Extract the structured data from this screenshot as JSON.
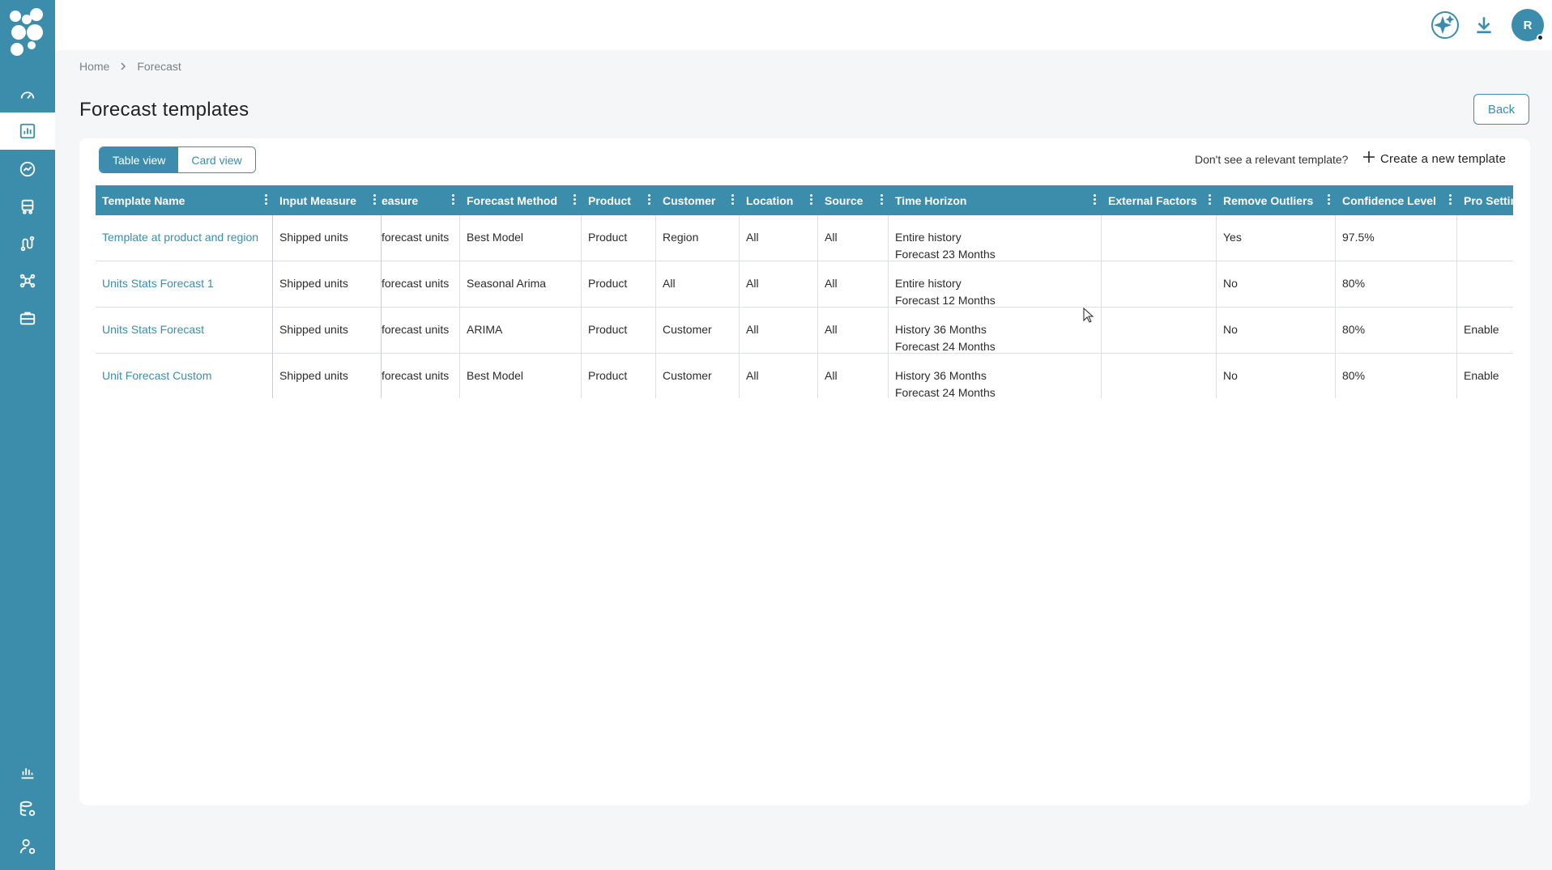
{
  "colors": {
    "accent": "#3b8dab",
    "header_text": "#ffffff",
    "link": "#3b8dab"
  },
  "sidebar": {
    "logo": "app-logo",
    "items": [
      {
        "icon": "speedometer-icon"
      },
      {
        "icon": "bar-chart-icon",
        "active": true
      },
      {
        "icon": "trend-icon"
      },
      {
        "icon": "truck-icon"
      },
      {
        "icon": "route-icon"
      },
      {
        "icon": "network-icon"
      },
      {
        "icon": "briefcase-icon"
      }
    ],
    "bottom_items": [
      {
        "icon": "report-icon"
      },
      {
        "icon": "database-settings-icon"
      },
      {
        "icon": "user-settings-icon"
      }
    ]
  },
  "topbar": {
    "icons": [
      "ai-sparkle-icon",
      "download-icon"
    ],
    "avatar_initial": "R"
  },
  "breadcrumb": {
    "home": "Home",
    "current": "Forecast"
  },
  "page": {
    "title": "Forecast templates",
    "back_label": "Back"
  },
  "toolbar": {
    "table_view": "Table view",
    "card_view": "Card view",
    "prompt": "Don't see a relevant template?",
    "create_label": "Create a new template"
  },
  "table": {
    "columns": [
      "Template Name",
      "Input Measure",
      "easure",
      "Forecast Method",
      "Product",
      "Customer",
      "Location",
      "Source",
      "Time Horizon",
      "External Factors",
      "Remove Outliers",
      "Confidence Level",
      "Pro Settin"
    ],
    "rows": [
      {
        "name": "Template at product and region",
        "input_measure": "Shipped units",
        "measure": "forecast units",
        "method": "Best Model",
        "product": "Product",
        "customer": "Region",
        "location": "All",
        "source": "All",
        "horizon_1": "Entire history",
        "horizon_2": "Forecast 23 Months",
        "external": "",
        "outliers": "Yes",
        "confidence": "97.5%",
        "pro": ""
      },
      {
        "name": "Units Stats Forecast 1",
        "input_measure": "Shipped units",
        "measure": "forecast units",
        "method": "Seasonal Arima",
        "product": "Product",
        "customer": "All",
        "location": "All",
        "source": "All",
        "horizon_1": "Entire history",
        "horizon_2": "Forecast 12 Months",
        "external": "",
        "outliers": "No",
        "confidence": "80%",
        "pro": ""
      },
      {
        "name": "Units Stats Forecast",
        "input_measure": "Shipped units",
        "measure": "forecast units",
        "method": "ARIMA",
        "product": "Product",
        "customer": "Customer",
        "location": "All",
        "source": "All",
        "horizon_1": "History 36 Months",
        "horizon_2": "Forecast 24 Months",
        "external": "",
        "outliers": "No",
        "confidence": "80%",
        "pro": "Enable"
      },
      {
        "name": "Unit Forecast Custom",
        "input_measure": "Shipped units",
        "measure": "forecast units",
        "method": "Best Model",
        "product": "Product",
        "customer": "Customer",
        "location": "All",
        "source": "All",
        "horizon_1": "History 36 Months",
        "horizon_2": "Forecast 24 Months",
        "external": "",
        "outliers": "No",
        "confidence": "80%",
        "pro": "Enable"
      }
    ]
  }
}
